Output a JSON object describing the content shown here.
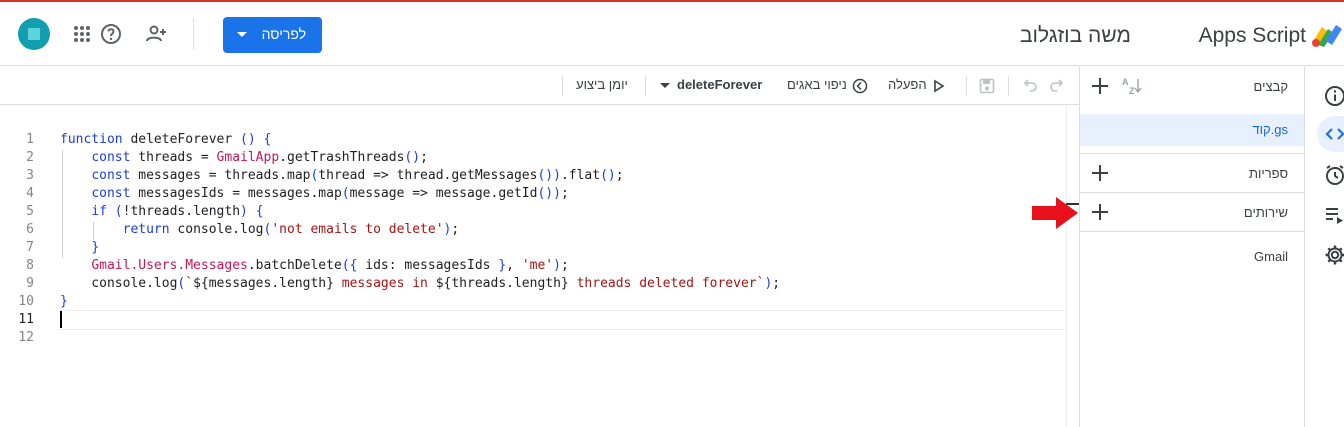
{
  "header": {
    "app_name": "Apps Script",
    "project_title": "משה בוזגלוב",
    "deploy_label": "לפריסה"
  },
  "toolbar": {
    "execution_log": "יומן ביצוע",
    "function_name": "deleteForever",
    "debug": "ניפוי באגים",
    "run": "הפעלה"
  },
  "editor": {
    "line_numbers": [
      "1",
      "2",
      "3",
      "4",
      "5",
      "6",
      "7",
      "8",
      "9",
      "10",
      "11",
      "12"
    ],
    "lines": [
      "function deleteForever () {",
      "    const threads = GmailApp.getTrashThreads();",
      "    const messages = threads.map(thread => thread.getMessages()).flat();",
      "    const messagesIds = messages.map(message => message.getId());",
      "    if (!threads.length) {",
      "        return console.log('not emails to delete');",
      "    }",
      "    Gmail.Users.Messages.batchDelete({ ids: messagesIds }, 'me');",
      "    console.log(`${messages.length} messages in ${threads.length} threads deleted forever`);",
      "}",
      "",
      ""
    ]
  },
  "files_panel": {
    "files_label": "קבצים",
    "active_file": "קוד.gs",
    "libraries_label": "ספריות",
    "services_label": "שירותים",
    "service_item": "Gmail"
  },
  "colors": {
    "accent": "#1a73e8",
    "keyword": "#1a3ed9",
    "builtin": "#c2185b",
    "string": "#a31515",
    "arrow": "#e8101a"
  }
}
